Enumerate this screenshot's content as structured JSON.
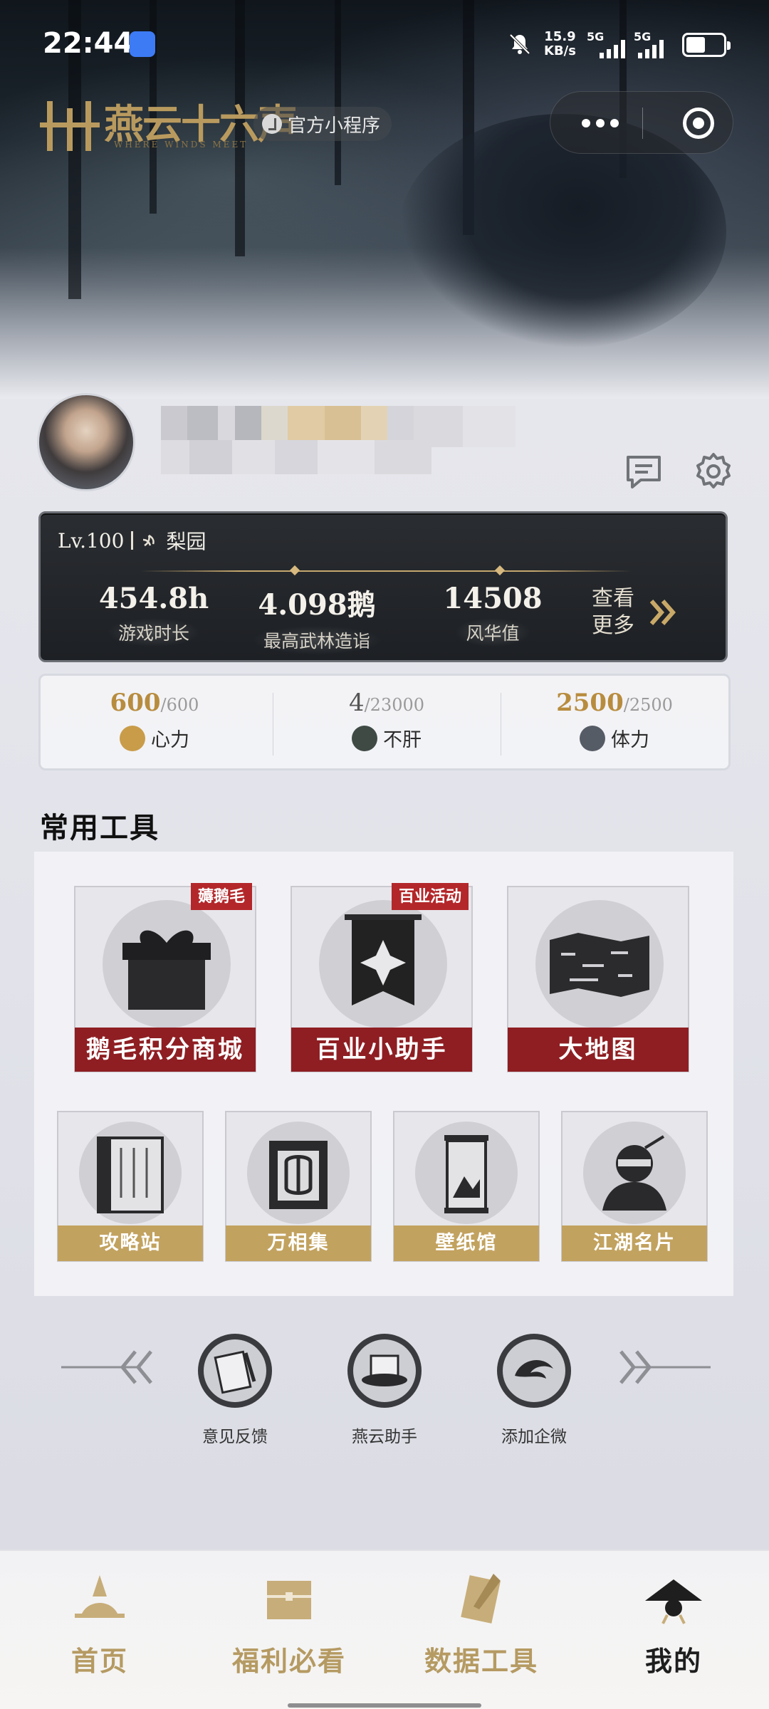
{
  "status_bar": {
    "time": "22:44",
    "net_speed_value": "15.9",
    "net_speed_unit": "KB/s",
    "sim1_label": "5G",
    "sim2_label": "5G",
    "icons": [
      "app-notification-icon",
      "mute-icon",
      "signal-icon",
      "battery-icon"
    ]
  },
  "header": {
    "logo_text": "燕云十六声",
    "logo_subtitle": "WHERE WINDS MEET",
    "official_label": "官方小程序"
  },
  "stats": {
    "level": "Lv.100",
    "sect": "梨园",
    "items": [
      {
        "value": "454.8h",
        "label": "游戏时长"
      },
      {
        "value": "4.098鹅",
        "label": "最高武林造诣"
      },
      {
        "value": "14508",
        "label": "风华值"
      }
    ],
    "view_more_line1": "查看",
    "view_more_line2": "更多"
  },
  "resources": [
    {
      "current": "600",
      "max": "/600",
      "name": "心力",
      "color": "#b88c3e"
    },
    {
      "current": "4",
      "max": "/23000",
      "name": "不肝",
      "color": "#555555"
    },
    {
      "current": "2500",
      "max": "/2500",
      "name": "体力",
      "color": "#b88c3e"
    }
  ],
  "section_title": "常用工具",
  "tools_big": [
    {
      "label": "鹅毛积分商城",
      "tag": "薅鹅毛",
      "icon": "gift-box-icon"
    },
    {
      "label": "百业小助手",
      "tag": "百业活动",
      "icon": "banner-icon"
    },
    {
      "label": "大地图",
      "tag": "",
      "icon": "map-scroll-icon"
    }
  ],
  "tools_small": [
    {
      "label": "攻略站",
      "icon": "guide-book-icon"
    },
    {
      "label": "万相集",
      "icon": "wardrobe-icon"
    },
    {
      "label": "壁纸馆",
      "icon": "wallpaper-scroll-icon"
    },
    {
      "label": "江湖名片",
      "icon": "card-portrait-icon"
    }
  ],
  "extras": [
    {
      "label": "意见反馈",
      "icon": "feedback-icon"
    },
    {
      "label": "燕云助手",
      "icon": "hat-icon"
    },
    {
      "label": "添加企微",
      "icon": "dragon-icon"
    }
  ],
  "bottom_nav": [
    {
      "label": "首页",
      "active": false
    },
    {
      "label": "福利必看",
      "active": false
    },
    {
      "label": "数据工具",
      "active": false
    },
    {
      "label": "我的",
      "active": true
    }
  ],
  "colors": {
    "gold": "#b88c3e",
    "red_label": "#8e1e22",
    "tag_red": "#b3272a",
    "gold_label": "#c2a25f",
    "nav_inactive": "#b59a62",
    "nav_active": "#1e1e1e"
  }
}
